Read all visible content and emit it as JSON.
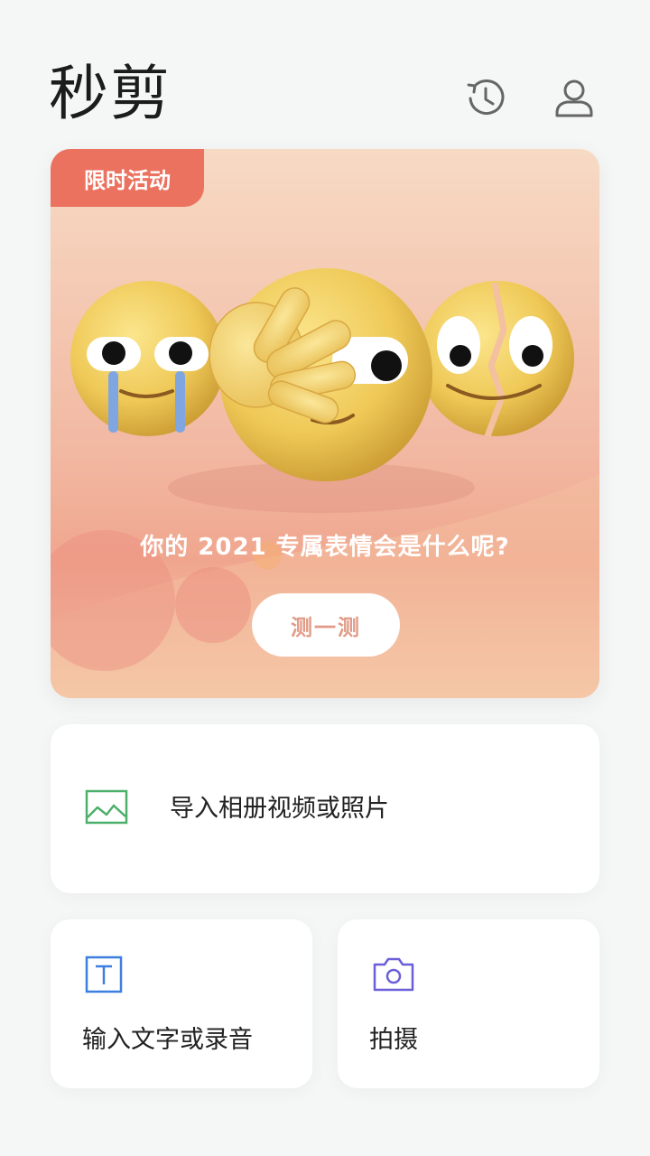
{
  "header": {
    "logo": "秒剪",
    "icons": [
      "history-icon",
      "user-profile-icon"
    ]
  },
  "banner": {
    "badge": "限时活动",
    "caption": "你的 2021 专属表情会是什么呢?",
    "button": "测一测",
    "colors": {
      "badge": "#ec7260",
      "button_text": "#e19c88"
    }
  },
  "actions": {
    "import": {
      "label": "导入相册视频或照片",
      "icon": "image-icon",
      "color": "#4caf6a"
    },
    "text": {
      "label": "输入文字或录音",
      "icon": "text-t-icon",
      "color": "#3d7fe0"
    },
    "shoot": {
      "label": "拍摄",
      "icon": "camera-icon",
      "color": "#6a5fd8"
    }
  }
}
